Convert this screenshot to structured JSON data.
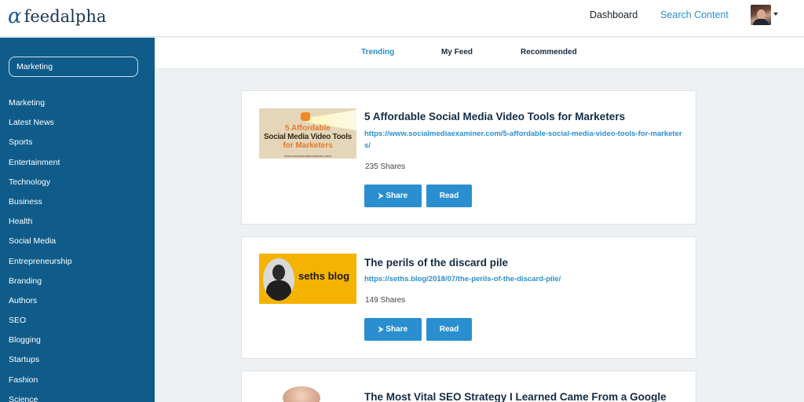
{
  "header": {
    "logo_mark": "α",
    "logo_text": "feedalpha",
    "nav": {
      "dashboard": "Dashboard",
      "search_content": "Search Content"
    }
  },
  "sidebar": {
    "search_value": "Marketing",
    "items": [
      "Marketing",
      "Latest News",
      "Sports",
      "Entertainment",
      "Technology",
      "Business",
      "Health",
      "Social Media",
      "Entrepreneurship",
      "Branding",
      "Authors",
      "SEO",
      "Blogging",
      "Startups",
      "Fashion",
      "Science"
    ]
  },
  "tabs": {
    "trending": "Trending",
    "my_feed": "My Feed",
    "recommended": "Recommended",
    "active": "trending"
  },
  "cards": [
    {
      "title": "5 Affordable Social Media Video Tools for Marketers",
      "url": "https://www.socialmediaexaminer.com/5-affordable-social-media-video-tools-for-marketers/",
      "shares": "235 Shares",
      "share_label": "Share",
      "read_label": "Read",
      "thumb": {
        "line1": "5 Affordable",
        "line2": "Social Media Video Tools",
        "line3": "for Marketers",
        "credit": "www.socialmediaexaminer.com"
      }
    },
    {
      "title": "The perils of the discard pile",
      "url": "https://seths.blog/2018/07/the-perils-of-the-discard-pile/",
      "shares": "149 Shares",
      "share_label": "Share",
      "read_label": "Read",
      "thumb": {
        "label": "seths blog"
      }
    },
    {
      "title": "The Most Vital SEO Strategy I Learned Came From a Google"
    }
  ],
  "colors": {
    "sidebar": "#0f5c8a",
    "accent": "#2a8fd0",
    "background": "#eef1f3"
  },
  "icons": {
    "share": "share-icon",
    "avatar": "user-avatar",
    "dropdown": "chevron-down-icon"
  }
}
